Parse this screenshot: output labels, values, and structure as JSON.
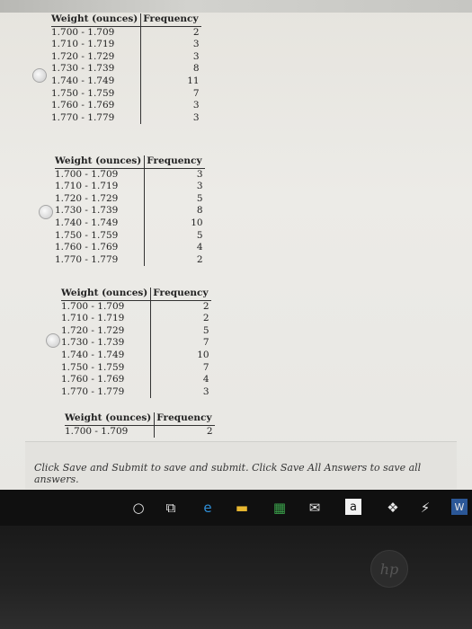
{
  "question": {
    "options": [
      {
        "header": [
          "Weight (ounces)",
          "Frequency"
        ],
        "rows": [
          [
            "1.700 - 1.709",
            "2"
          ],
          [
            "1.710 - 1.719",
            "3"
          ],
          [
            "1.720 - 1.729",
            "3"
          ],
          [
            "1.730 - 1.739",
            "8"
          ],
          [
            "1.740 - 1.749",
            "11"
          ],
          [
            "1.750 - 1.759",
            "7"
          ],
          [
            "1.760 - 1.769",
            "3"
          ],
          [
            "1.770 - 1.779",
            "3"
          ]
        ]
      },
      {
        "header": [
          "Weight (ounces)",
          "Frequency"
        ],
        "rows": [
          [
            "1.700 - 1.709",
            "3"
          ],
          [
            "1.710 - 1.719",
            "3"
          ],
          [
            "1.720 - 1.729",
            "5"
          ],
          [
            "1.730 - 1.739",
            "8"
          ],
          [
            "1.740 - 1.749",
            "10"
          ],
          [
            "1.750 - 1.759",
            "5"
          ],
          [
            "1.760 - 1.769",
            "4"
          ],
          [
            "1.770 - 1.779",
            "2"
          ]
        ]
      },
      {
        "header": [
          "Weight (ounces)",
          "Frequency"
        ],
        "rows": [
          [
            "1.700 - 1.709",
            "2"
          ],
          [
            "1.710 - 1.719",
            "2"
          ],
          [
            "1.720 - 1.729",
            "5"
          ],
          [
            "1.730 - 1.739",
            "7"
          ],
          [
            "1.740 - 1.749",
            "10"
          ],
          [
            "1.750 - 1.759",
            "7"
          ],
          [
            "1.760 - 1.769",
            "4"
          ],
          [
            "1.770 - 1.779",
            "3"
          ]
        ]
      },
      {
        "header": [
          "Weight (ounces)",
          "Frequency"
        ],
        "rows": [
          [
            "1.700 - 1.709",
            "2"
          ]
        ]
      }
    ]
  },
  "footer": {
    "instruction": "Click Save and Submit to save and submit. Click Save All Answers to save all answers."
  },
  "taskbar": {
    "icons": [
      {
        "name": "cortana-icon",
        "glyph": "○"
      },
      {
        "name": "task-view-icon",
        "glyph": "⧉"
      },
      {
        "name": "edge-icon",
        "glyph": "e"
      },
      {
        "name": "file-explorer-icon",
        "glyph": "▬"
      },
      {
        "name": "store-icon",
        "glyph": "▦"
      },
      {
        "name": "mail-icon",
        "glyph": "✉"
      },
      {
        "name": "amazon-icon",
        "glyph": "a"
      },
      {
        "name": "dropbox-icon",
        "glyph": "❖"
      },
      {
        "name": "lightning-icon",
        "glyph": "⚡"
      },
      {
        "name": "word-icon",
        "glyph": "W"
      }
    ]
  },
  "device": {
    "logo": "hp"
  },
  "colors": {
    "edge_blue": "#2f8fd8",
    "explorer_yellow": "#e8b730",
    "store_green": "#3aa04a",
    "word_blue": "#2b5797"
  }
}
